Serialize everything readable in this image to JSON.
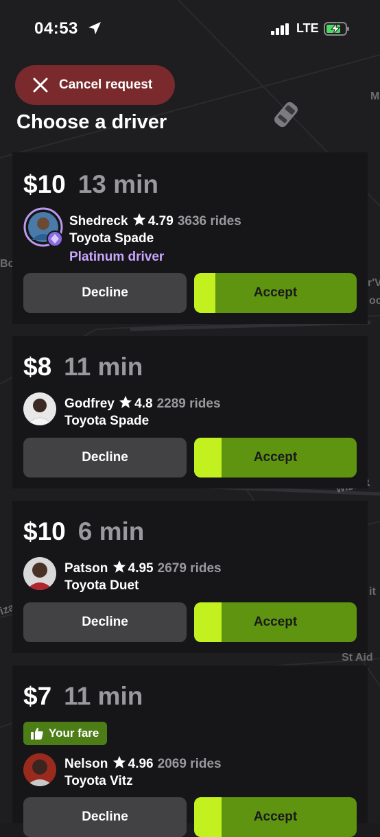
{
  "status_bar": {
    "time": "04:53",
    "network": "LTE"
  },
  "cancel": {
    "label": "Cancel request"
  },
  "title": "Choose a driver",
  "map_labels": [
    "Bo",
    "M",
    "r'V",
    "oc",
    "St Aid",
    "wiza R",
    "iza",
    "it"
  ],
  "offers": [
    {
      "price": "$10",
      "eta": "13 min",
      "name": "Shedreck",
      "rating": "4.79",
      "rides": "3636 rides",
      "car": "Toyota Spade",
      "tier": "Platinum driver",
      "decline": "Decline",
      "accept": "Accept",
      "accept_progress": 0.13
    },
    {
      "price": "$8",
      "eta": "11 min",
      "name": "Godfrey",
      "rating": "4.8",
      "rides": "2289 rides",
      "car": "Toyota Spade",
      "decline": "Decline",
      "accept": "Accept",
      "accept_progress": 0.17
    },
    {
      "price": "$10",
      "eta": "6 min",
      "name": "Patson",
      "rating": "4.95",
      "rides": "2679 rides",
      "car": "Toyota Duet",
      "decline": "Decline",
      "accept": "Accept",
      "accept_progress": 0.17
    },
    {
      "price": "$7",
      "eta": "11 min",
      "badge": "Your fare",
      "name": "Nelson",
      "rating": "4.96",
      "rides": "2069 rides",
      "car": "Toyota Vitz",
      "decline": "Decline",
      "accept": "Accept",
      "accept_progress": 0.17
    }
  ],
  "colors": {
    "accept_dark": "#5e9410",
    "accept_light": "#c3f11f",
    "decline": "#424245",
    "cancel": "#7a2a2c",
    "platinum": "#c9a7ff",
    "fare_badge": "#4d7d16"
  }
}
